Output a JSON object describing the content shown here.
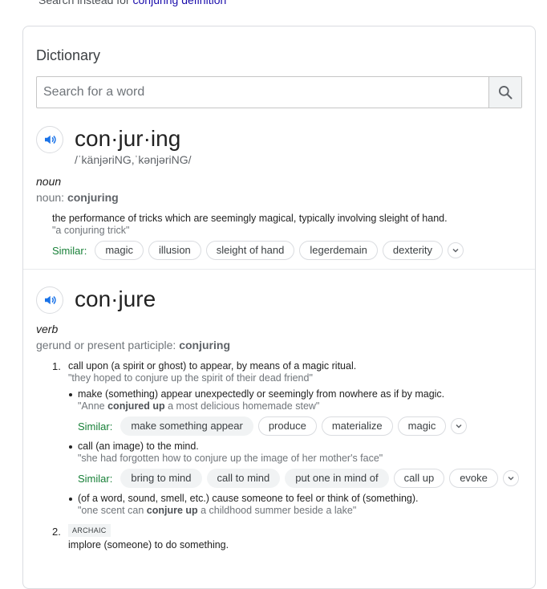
{
  "top_link": {
    "prefix": "Search instead for",
    "link": "conjuring definition"
  },
  "card": {
    "title": "Dictionary"
  },
  "search": {
    "placeholder": "Search for a word"
  },
  "entry1": {
    "headword": "con·jur·ing",
    "phonetic": "/ˈkänjəriNG,ˈkənjəriNG/",
    "pos": "noun",
    "form_prefix": "noun: ",
    "form_word": "conjuring",
    "definition": "the performance of tricks which are seemingly magical, typically involving sleight of hand.",
    "example": "\"a conjuring trick\"",
    "similar_label": "Similar:",
    "similar": [
      "magic",
      "illusion",
      "sleight of hand",
      "legerdemain",
      "dexterity"
    ]
  },
  "entry2": {
    "headword": "con·jure",
    "pos": "verb",
    "form_prefix": "gerund or present participle: ",
    "form_word": "conjuring",
    "sense1": {
      "num": "1.",
      "definition": "call upon (a spirit or ghost) to appear, by means of a magic ritual.",
      "example": "\"they hoped to conjure up the spirit of their dead friend\"",
      "sub1": {
        "definition": "make (something) appear unexpectedly or seemingly from nowhere as if by magic.",
        "example_pre": "\"Anne ",
        "example_bold": "conjured up",
        "example_post": " a most delicious homemade stew\"",
        "similar_label": "Similar:",
        "similar": [
          "make something appear",
          "produce",
          "materialize",
          "magic"
        ]
      },
      "sub2": {
        "definition": "call (an image) to the mind.",
        "example": "\"she had forgotten how to conjure up the image of her mother's face\"",
        "similar_label": "Similar:",
        "similar": [
          "bring to mind",
          "call to mind",
          "put one in mind of",
          "call up",
          "evoke"
        ]
      },
      "sub3": {
        "definition": "(of a word, sound, smell, etc.) cause someone to feel or think of (something).",
        "example_pre": "\"one scent can ",
        "example_bold": "conjure up",
        "example_post": " a childhood summer beside a lake\""
      }
    },
    "sense2": {
      "num": "2.",
      "badge": "ARCHAIC",
      "definition": "implore (someone) to do something."
    }
  },
  "icons": {
    "search": "search-icon",
    "speaker": "speaker-icon",
    "more": "chevron-down-icon"
  },
  "colors": {
    "similar_label": "#188038",
    "speaker": "#1a73e8",
    "link": "#1a0dab"
  }
}
